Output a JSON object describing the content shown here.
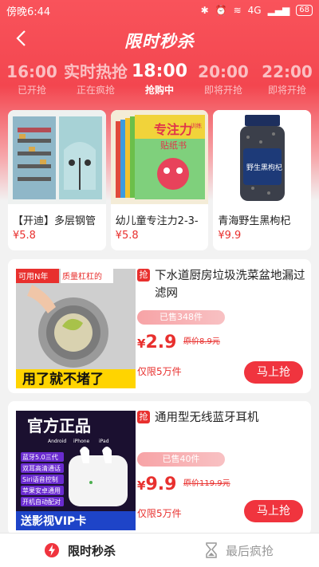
{
  "status_bar": {
    "time": "傍晚6:44",
    "network": "4G",
    "battery": "68"
  },
  "header": {
    "title": "限时秒杀"
  },
  "time_tabs": [
    {
      "time": "16:00",
      "status": "已开抢"
    },
    {
      "time": "实时热抢",
      "status": "正在疯抢"
    },
    {
      "time": "18:00",
      "status": "抢购中"
    },
    {
      "time": "20:00",
      "status": "即将开抢"
    },
    {
      "time": "22:00",
      "status": "即将开抢"
    }
  ],
  "top_products": [
    {
      "name": "【开迪】多层钢管",
      "price": "¥5.8"
    },
    {
      "name": "幼儿童专注力2-3-",
      "price": "¥5.8"
    },
    {
      "name": "青海野生黑枸杞",
      "price": "¥9.9"
    }
  ],
  "product_list": [
    {
      "badge": "抢",
      "title": "下水道厨房垃圾洗菜盆地漏过滤网",
      "sold": "已售348件",
      "currency": "¥",
      "price": "2.9",
      "original_price": "原价8.9元",
      "limit": "仅限5万件",
      "buy_label": "马上抢",
      "image_text_top_left": "可用N年",
      "image_text_top_right": "质量杠杠的",
      "image_text_bottom": "用了就不堵了"
    },
    {
      "badge": "抢",
      "title": "通用型无线蓝牙耳机",
      "sold": "已售40件",
      "currency": "¥",
      "price": "9.9",
      "original_price": "原价119.9元",
      "limit": "仅限5万件",
      "buy_label": "马上抢",
      "image_text_top": "官方正品",
      "image_features": [
        "蓝牙5.0三代",
        "双耳高清通话",
        "Siri语音控制",
        "苹果安卓通用",
        "开机自动配对"
      ],
      "image_text_bottom": "送影视VIP卡"
    }
  ],
  "product_image_text": {
    "book_title": "专注力",
    "book_tag": "训练",
    "book_sub": "贴纸书",
    "jar_label": "野生黑枸杞"
  },
  "bottom_tabs": [
    {
      "label": "限时秒杀",
      "icon": "flash-icon"
    },
    {
      "label": "最后疯抢",
      "icon": "hourglass-icon"
    }
  ],
  "colors": {
    "accent": "#f0343e",
    "price": "#e8302e"
  }
}
